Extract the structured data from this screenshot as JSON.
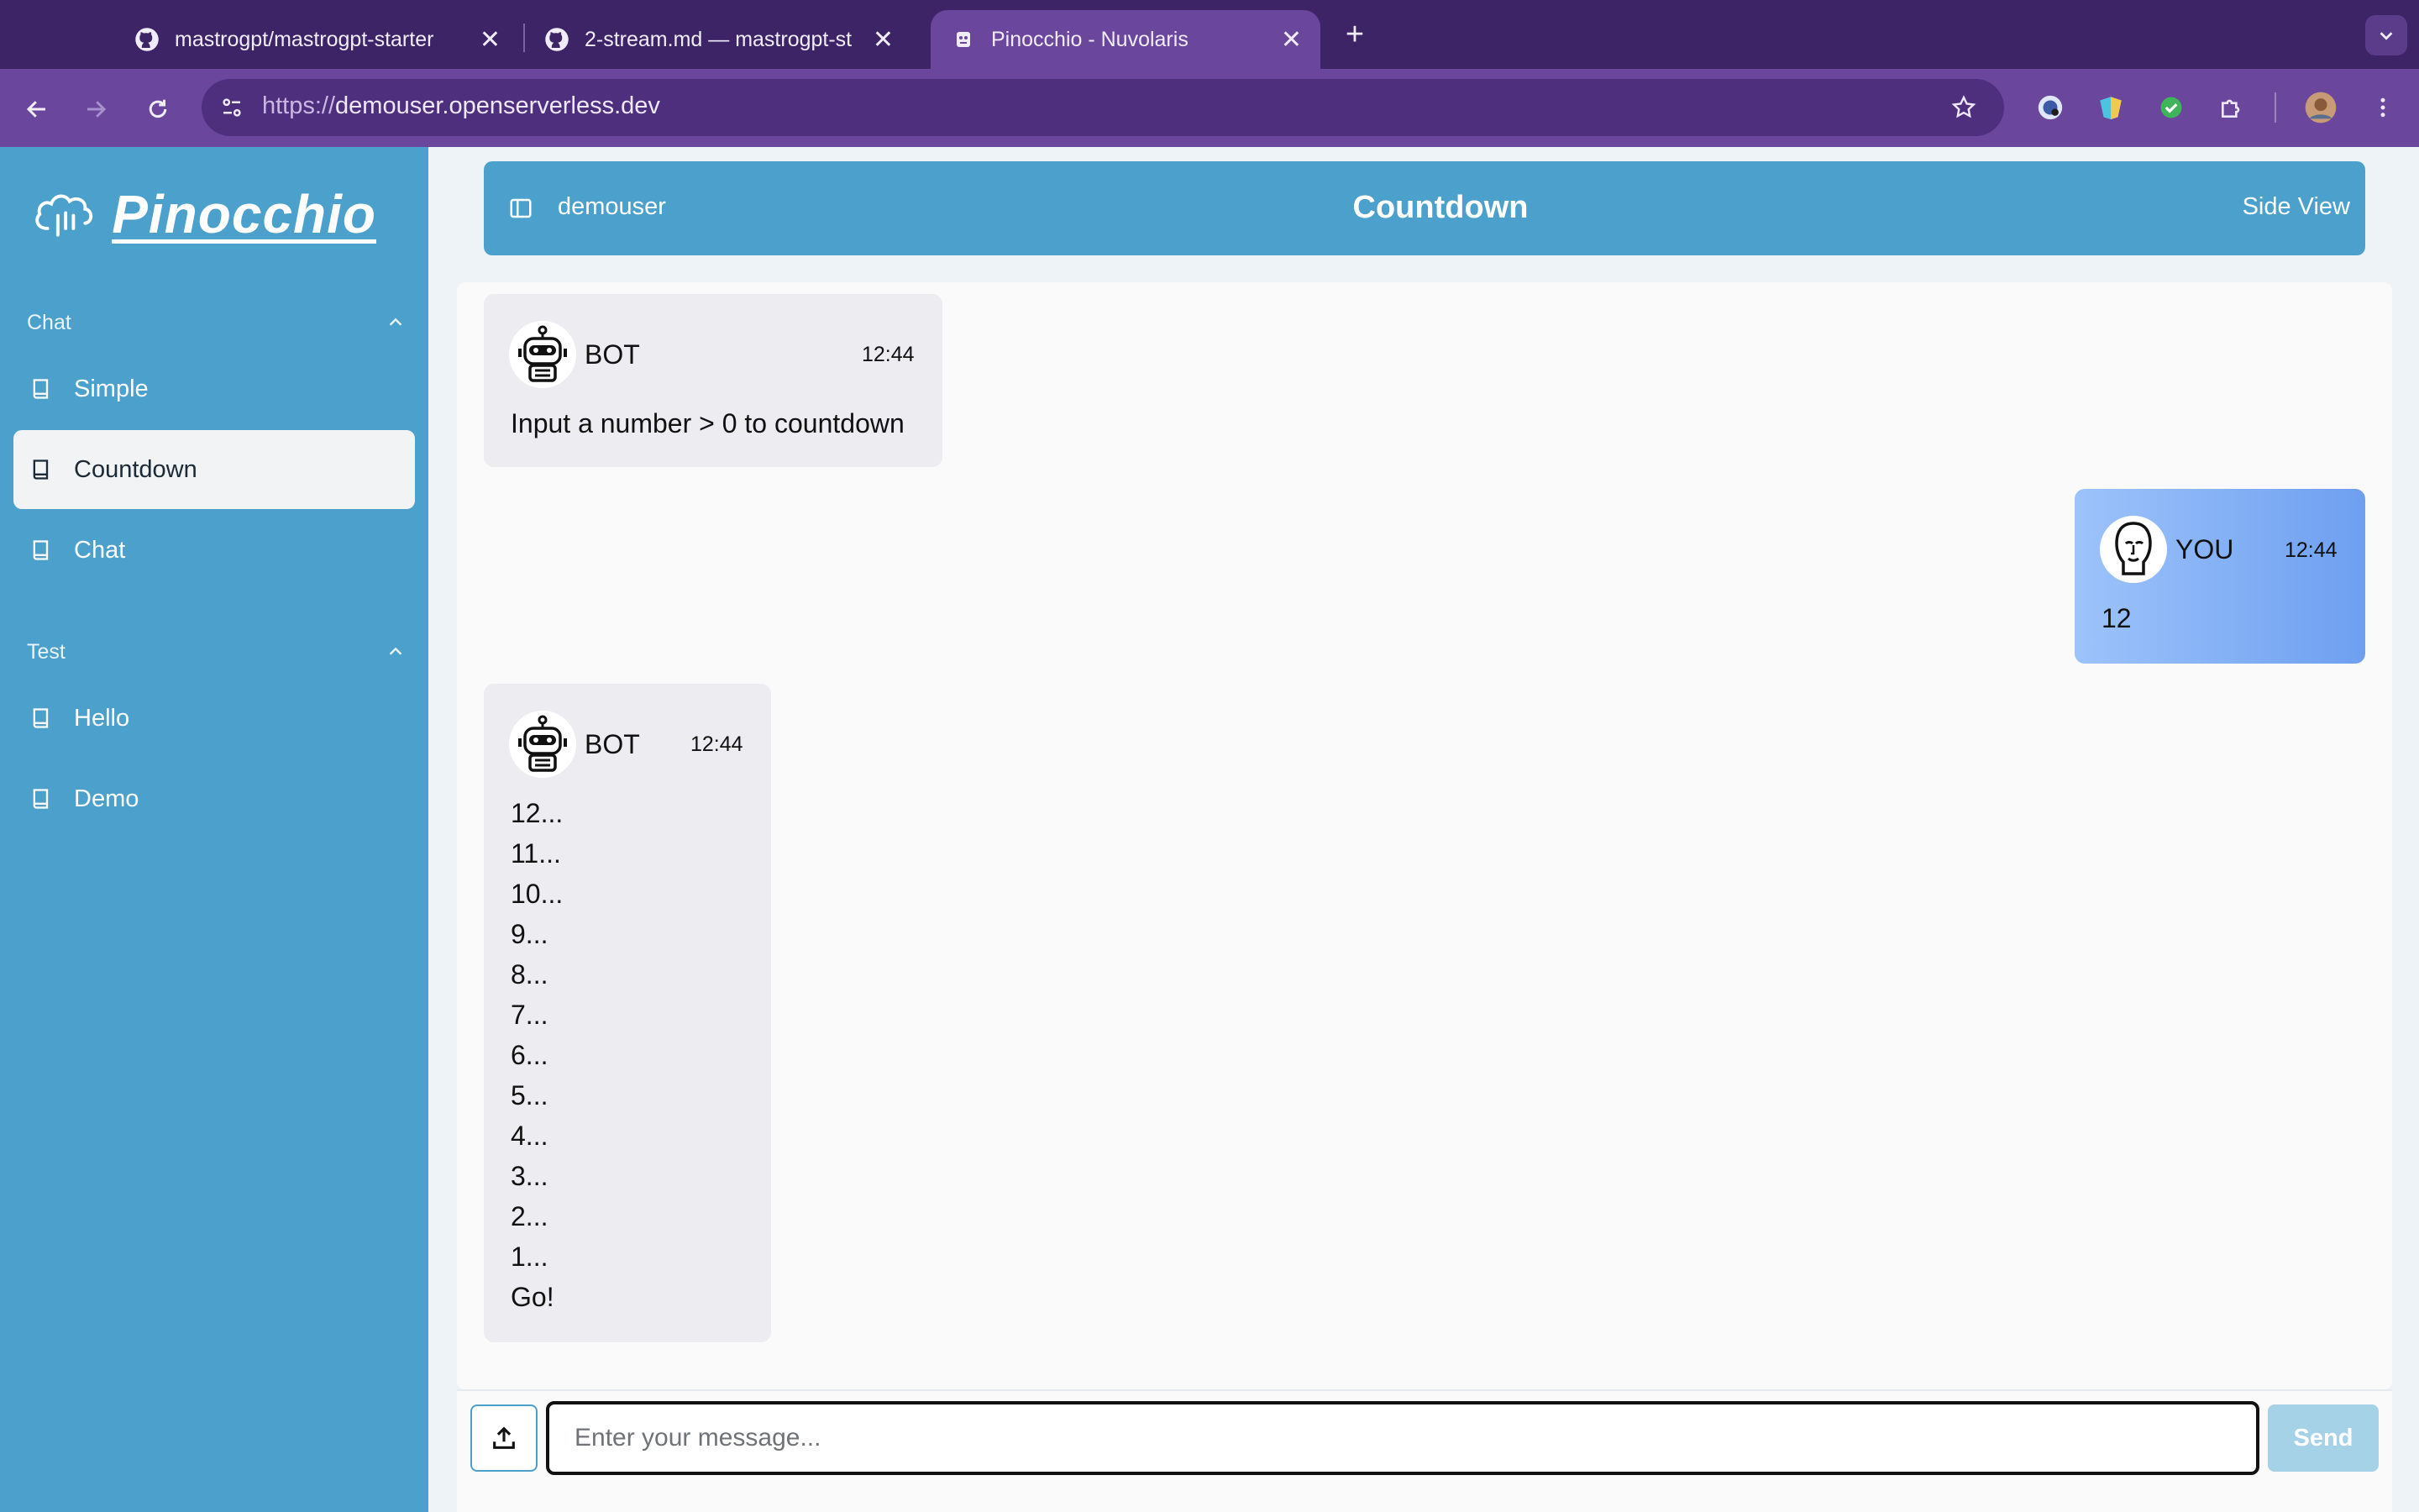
{
  "browser": {
    "tabs": [
      {
        "title": "mastrogpt/mastrogpt-starter",
        "icon": "github-icon",
        "active": false
      },
      {
        "title": "2-stream.md — mastrogpt-st",
        "icon": "github-icon",
        "active": false
      },
      {
        "title": "Pinocchio - Nuvolaris",
        "icon": "pinocchio-favicon",
        "active": true
      }
    ],
    "url_scheme": "https://",
    "url_host": "demouser.openserverless.dev"
  },
  "sidebar": {
    "logo_text": "Pinocchio",
    "sections": [
      {
        "label": "Chat",
        "items": [
          "Simple",
          "Countdown",
          "Chat"
        ]
      },
      {
        "label": "Test",
        "items": [
          "Hello",
          "Demo"
        ]
      }
    ],
    "selected": "Countdown"
  },
  "topbar": {
    "user": "demouser",
    "title": "Countdown",
    "side_view": "Side View"
  },
  "messages": [
    {
      "sender": "BOT",
      "time": "12:44",
      "text": "Input a number > 0 to countdown"
    },
    {
      "sender": "YOU",
      "time": "12:44",
      "text": "12"
    },
    {
      "sender": "BOT",
      "time": "12:44",
      "lines": [
        "12...",
        "11...",
        "10...",
        "9...",
        "8...",
        "7...",
        "6...",
        "5...",
        "4...",
        "3...",
        "2...",
        "1...",
        "Go!"
      ]
    }
  ],
  "composer": {
    "placeholder": "Enter your message...",
    "send_label": "Send"
  },
  "colors": {
    "sidebar": "#4ba0cc",
    "tabstrip": "#3c2466",
    "toolbar": "#6a469c",
    "user_bubble": "#7ea9f3",
    "bot_bubble": "#ececf1"
  }
}
